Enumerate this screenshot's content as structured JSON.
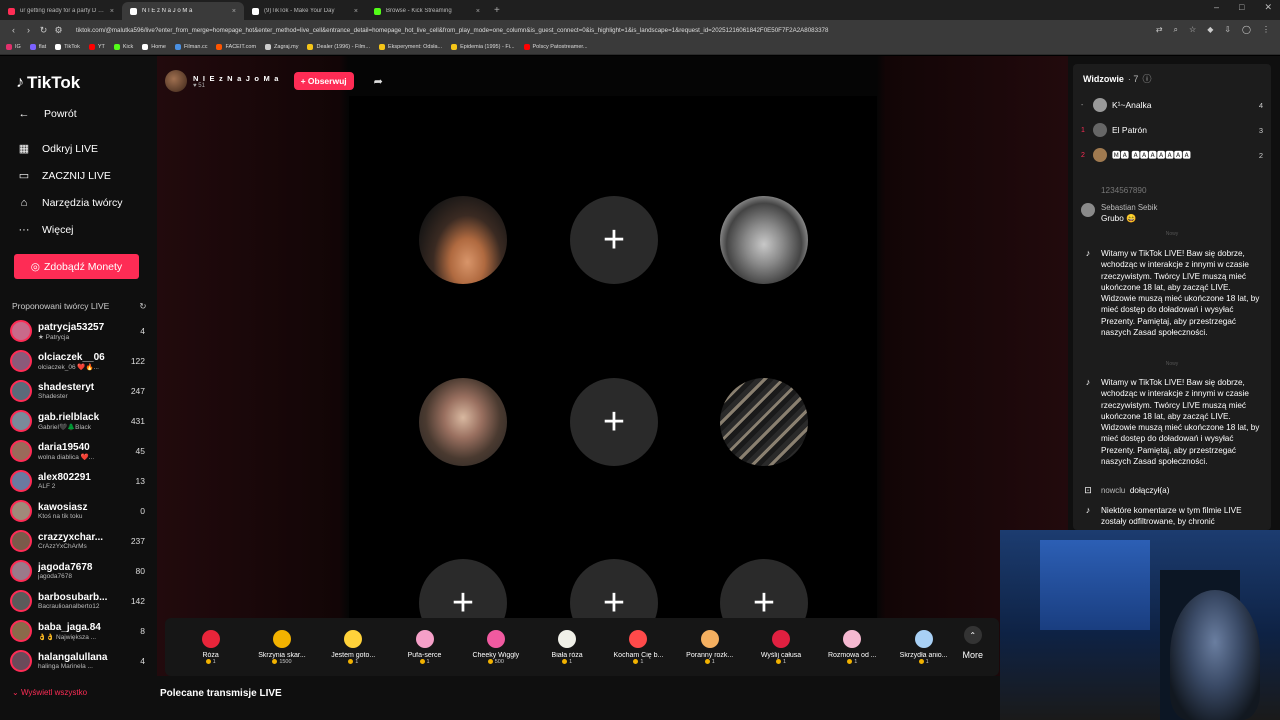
{
  "browser": {
    "tabs": [
      {
        "title": "ur getting ready for a party D p...",
        "color": "#ff2d55",
        "active": false
      },
      {
        "title": "N I E z N a J o M a",
        "color": "#ffffff",
        "active": true
      },
      {
        "title": "(9)TikTok - Make Your Day",
        "color": "#ffffff",
        "active": false
      },
      {
        "title": "Browse - Kick Streaming",
        "color": "#53fc18",
        "active": false
      }
    ],
    "new_tab": "+",
    "url": "tiktok.com/@malutka596/live?enter_from_merge=homepage_hot&enter_method=live_cell&entrance_detail=homepage_hot_live_cell&from_play_mode=one_column&is_guest_connect=0&is_highlight=1&is_landscape=1&request_id=20251216061842F0E50F7F2A2A8083378",
    "bookmarks": [
      {
        "label": "IG",
        "color": "#e1306c"
      },
      {
        "label": "flat",
        "color": "#7b61ff"
      },
      {
        "label": "TikTok",
        "color": "#ffffff"
      },
      {
        "label": "YT",
        "color": "#ff0000"
      },
      {
        "label": "Kick",
        "color": "#53fc18"
      },
      {
        "label": "Home",
        "color": "#ffffff"
      },
      {
        "label": "Filman.cc",
        "color": "#4a90e2"
      },
      {
        "label": "FACEIT.com",
        "color": "#ff5500"
      },
      {
        "label": "Zagraj.my",
        "color": "#cccccc"
      },
      {
        "label": "Dealer (1996) - Film...",
        "color": "#f5c518"
      },
      {
        "label": "Eksperyment: Odsła...",
        "color": "#f5c518"
      },
      {
        "label": "Epidemia (1995) - Fi...",
        "color": "#f5c518"
      },
      {
        "label": "Polscy Patostreamer...",
        "color": "#ff0000"
      }
    ]
  },
  "sidebar": {
    "logo": "TikTok",
    "nav": [
      {
        "label": "Powrót",
        "icon": "←",
        "name": "back"
      },
      {
        "label": "Odkryj LIVE",
        "icon": "▦",
        "name": "discover-live"
      },
      {
        "label": "ZACZNIJ LIVE",
        "icon": "▭",
        "name": "start-live"
      },
      {
        "label": "Narzędzia twórcy",
        "icon": "⌂",
        "name": "creator-tools"
      },
      {
        "label": "Więcej",
        "icon": "···",
        "name": "more"
      }
    ],
    "coins_button": "Zdobądź Monety",
    "proposed_title": "Proponowani twórcy LIVE",
    "creators": [
      {
        "name": "patrycja53257",
        "sub": "★ Patrycja",
        "count": "4"
      },
      {
        "name": "olciaczek__06",
        "sub": "olciaczek_06 ❤️🔥...",
        "count": "122"
      },
      {
        "name": "shadesteryt",
        "sub": "Shadester",
        "count": "247"
      },
      {
        "name": "gab.rielblack",
        "sub": "Gabriel🖤🌲Black",
        "count": "431"
      },
      {
        "name": "daria19540",
        "sub": "wolna diablica ❤️...",
        "count": "45"
      },
      {
        "name": "alex802291",
        "sub": "ALF 2",
        "count": "13"
      },
      {
        "name": "kawosiasz",
        "sub": "Ktoś na tik toku",
        "count": "0"
      },
      {
        "name": "crazzyxchar...",
        "sub": "CrAzzYxChArMs",
        "count": "237"
      },
      {
        "name": "jagoda7678",
        "sub": "jagoda7678",
        "count": "80"
      },
      {
        "name": "barbosubarb...",
        "sub": "Bacraulioanalberto12",
        "count": "142"
      },
      {
        "name": "baba_jaga.84",
        "sub": "👌👌 Największa ...",
        "count": "8"
      },
      {
        "name": "halangalullana",
        "sub": "halinga Marinela ...",
        "count": "4"
      }
    ],
    "show_more": "Wyświetl wszystko"
  },
  "stream": {
    "host_name": "N I E z N a J o M a",
    "host_likes": "51",
    "follow_label": "+ Obserwuj",
    "seats": [
      "user",
      "empty",
      "user",
      "user",
      "empty",
      "user",
      "empty",
      "empty",
      "empty"
    ],
    "seat_plus": "+"
  },
  "gifts": [
    {
      "name": "Róża",
      "price": "1",
      "color": "#e8253a"
    },
    {
      "name": "Skrzynia skar...",
      "price": "1500",
      "color": "#f2b200"
    },
    {
      "name": "Jestem goto...",
      "price": "1",
      "color": "#ffd23a"
    },
    {
      "name": "Pufa-serce",
      "price": "1",
      "color": "#f5a0c8"
    },
    {
      "name": "Cheeky Wiggly",
      "price": "500",
      "color": "#f05aa0"
    },
    {
      "name": "Biała róża",
      "price": "1",
      "color": "#f0f0e8"
    },
    {
      "name": "Kocham Cię b...",
      "price": "1",
      "color": "#ff4a4a"
    },
    {
      "name": "Poranny rozk...",
      "price": "1",
      "color": "#f5b060"
    },
    {
      "name": "Wyślij całusa",
      "price": "1",
      "color": "#e02040"
    },
    {
      "name": "Rozmowa od ...",
      "price": "1",
      "color": "#f5b8d0"
    },
    {
      "name": "Skrzydła anio...",
      "price": "1",
      "color": "#a8d0f5"
    }
  ],
  "gift_more": "More",
  "section_title": "Polecane transmisje LIVE",
  "viewers": {
    "title": "Widzowie",
    "count": "· 7",
    "list": [
      {
        "rank": "-",
        "name": "K¹~Analka",
        "count": "4",
        "red": false
      },
      {
        "rank": "1",
        "name": "El Patrón",
        "count": "3",
        "red": true
      },
      {
        "rank": "2",
        "name": "🅼🅰 🅰🅰🅰🅰🅰🅰🅰",
        "count": "2",
        "red": true
      }
    ]
  },
  "chat": {
    "partial_top": "1234567890",
    "m1_name": "Sebastian Sebik",
    "m1_text": "Grubo 😄",
    "divider": "Nowy",
    "system": "Witamy w TikTok LIVE! Baw się dobrze, wchodząc w interakcje z innymi w czasie rzeczywistym. Twórcy LIVE muszą mieć ukończone 18 lat, aby zacząć LIVE. Widzowie muszą mieć ukończone 18 lat, by mieć dostęp do doładowań i wysyłać Prezenty. Pamiętaj, aby przestrzegać naszych Zasad społeczności.",
    "join_name": "nowclu",
    "join_text": "dołączył(a)",
    "filter_text": "Niektóre komentarze w tym filmie LIVE zostały odfiltrowane, by chronić"
  }
}
